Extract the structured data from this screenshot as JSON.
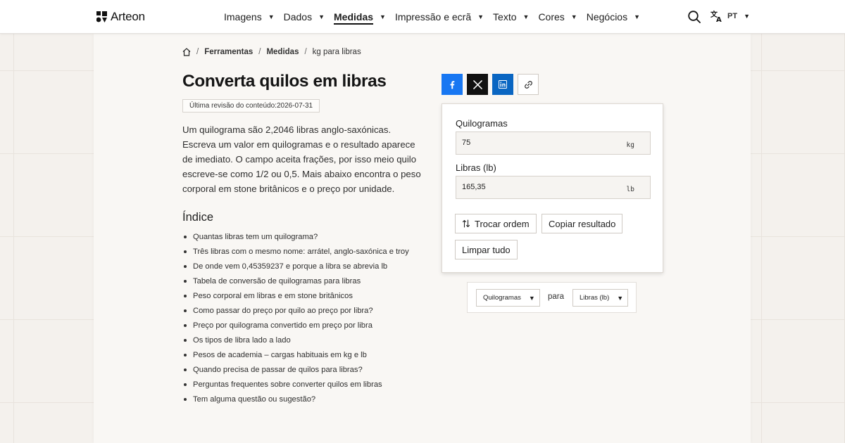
{
  "header": {
    "brand": "Arteon",
    "nav": [
      {
        "label": "Imagens",
        "active": false
      },
      {
        "label": "Dados",
        "active": false
      },
      {
        "label": "Medidas",
        "active": true
      },
      {
        "label": "Impressão e ecrã",
        "active": false
      },
      {
        "label": "Texto",
        "active": false
      },
      {
        "label": "Cores",
        "active": false
      },
      {
        "label": "Negócios",
        "active": false
      }
    ],
    "language": "PT"
  },
  "breadcrumb": {
    "items": [
      "Ferramentas",
      "Medidas"
    ],
    "current": "kg para libras"
  },
  "page": {
    "title": "Converta quilos em libras",
    "revision_label": "Última revisão do conteúdo:",
    "revision_date": "2026-07-31",
    "intro": "Um quilograma são 2,2046 libras anglo-saxónicas. Escreva um valor em quilogramas e o resultado aparece de imediato. O campo aceita frações, por isso meio quilo escreve-se como 1/2 ou 0,5. Mais abaixo encontra o peso corporal em stone britânicos e o preço por unidade.",
    "toc_title": "Índice",
    "toc": [
      "Quantas libras tem um quilograma?",
      "Três libras com o mesmo nome: arrátel, anglo-saxónica e troy",
      "De onde vem 0,45359237 e porque a libra se abrevia lb",
      "Tabela de conversão de quilogramas para libras",
      "Peso corporal em libras e em stone britânicos",
      "Como passar do preço por quilo ao preço por libra?",
      "Preço por quilograma convertido em preço por libra",
      "Os tipos de libra lado a lado",
      "Pesos de academia – cargas habituais em kg e lb",
      "Quando precisa de passar de quilos para libras?",
      "Perguntas frequentes sobre converter quilos em libras",
      "Tem alguma questão ou sugestão?"
    ]
  },
  "share": {
    "icons": [
      "facebook-icon",
      "x-icon",
      "linkedin-icon",
      "link-icon"
    ]
  },
  "converter": {
    "from_label": "Quilogramas",
    "from_value": "75",
    "from_unit": "kg",
    "to_label": "Libras (lb)",
    "to_value": "165,35",
    "to_unit": "lb",
    "swap_label": "Trocar ordem",
    "copy_label": "Copiar resultado",
    "clear_label": "Limpar tudo"
  },
  "unit_select": {
    "from": "Quilogramas",
    "connector": "para",
    "to": "Libras (lb)"
  },
  "colors": {
    "facebook": "#1877f2",
    "x": "#111111",
    "linkedin": "#0a66c2",
    "background": "#f4f1ed"
  }
}
